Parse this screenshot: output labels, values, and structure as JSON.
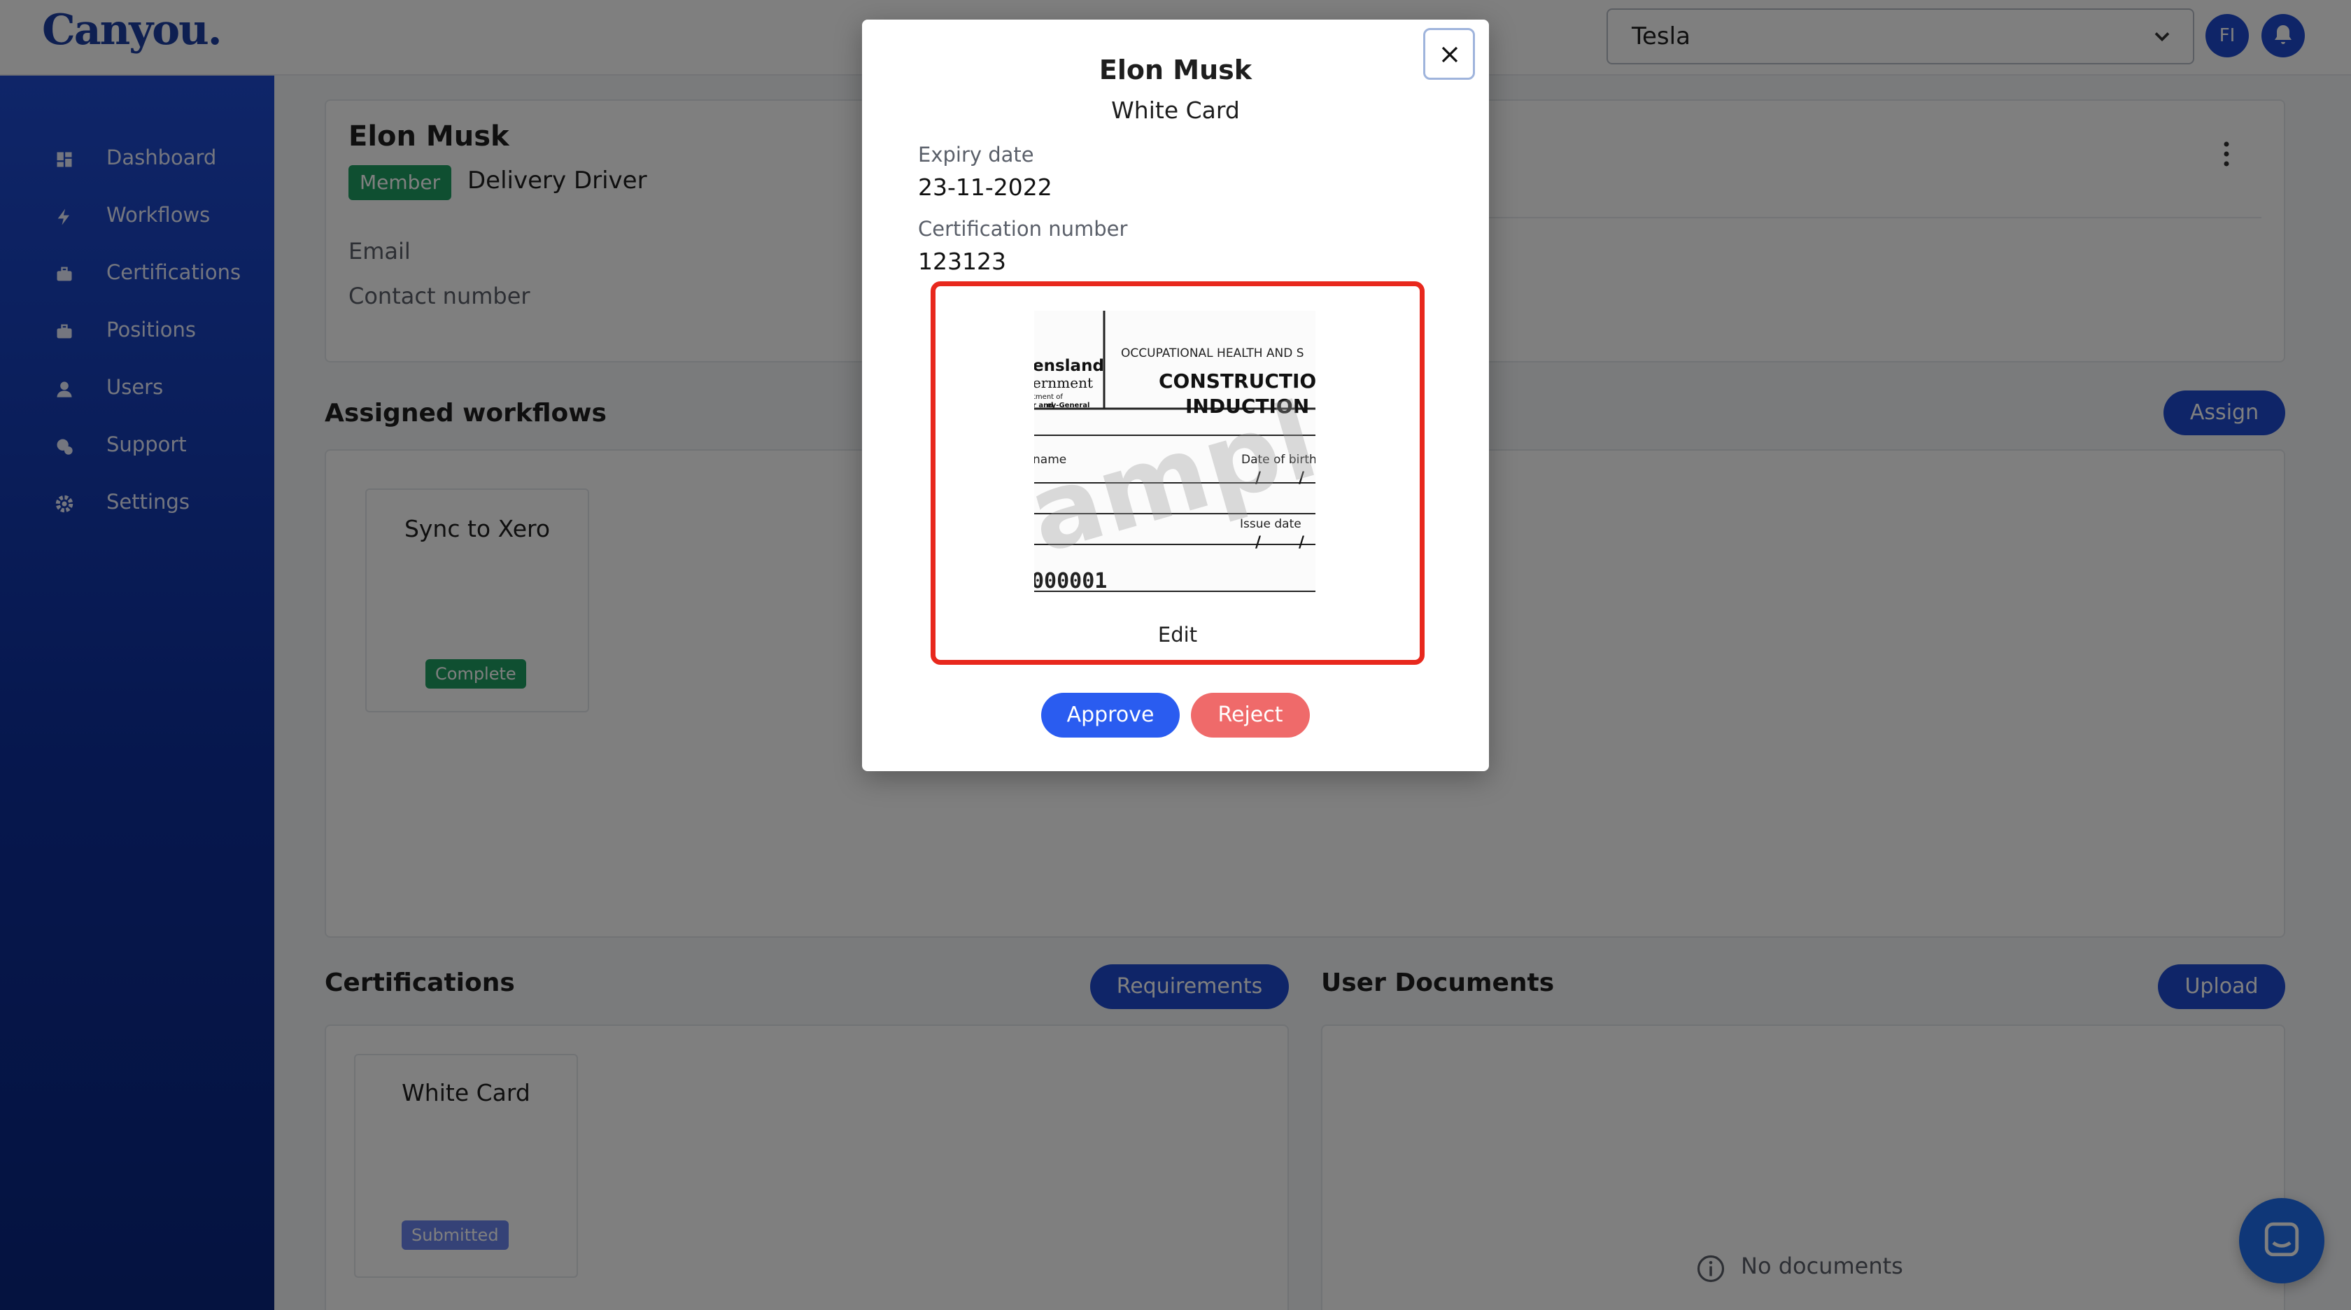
{
  "app": {
    "logo": "Canyou.",
    "company_select": "Tesla",
    "user_initials": "FI"
  },
  "sidebar": {
    "items": [
      {
        "label": "Dashboard",
        "icon": "dashboard-icon"
      },
      {
        "label": "Workflows",
        "icon": "bolt-icon"
      },
      {
        "label": "Certifications",
        "icon": "briefcase-icon"
      },
      {
        "label": "Positions",
        "icon": "briefcase-icon"
      },
      {
        "label": "Users",
        "icon": "user-icon"
      },
      {
        "label": "Support",
        "icon": "support-icon"
      },
      {
        "label": "Settings",
        "icon": "gear-icon"
      }
    ]
  },
  "profile": {
    "name": "Elon Musk",
    "role_badge": "Member",
    "position": "Delivery Driver",
    "email_label": "Email",
    "contact_label": "Contact number"
  },
  "workflows": {
    "title": "Assigned workflows",
    "assign_label": "Assign",
    "items": [
      {
        "title": "Sync to Xero",
        "status": "Complete"
      }
    ]
  },
  "certifications": {
    "title": "Certifications",
    "requirements_label": "Requirements",
    "items": [
      {
        "title": "White Card",
        "status": "Submitted"
      }
    ]
  },
  "documents": {
    "title": "User Documents",
    "upload_label": "Upload",
    "empty_text": "No documents"
  },
  "modal": {
    "title": "Elon Musk",
    "subtitle": "White Card",
    "expiry_label": "Expiry date",
    "expiry_value": "23-11-2022",
    "cert_number_label": "Certification number",
    "cert_number_value": "123123",
    "edit_label": "Edit",
    "approve_label": "Approve",
    "reject_label": "Reject",
    "card_image": {
      "org_line1": "ensland",
      "org_line2": "ernment",
      "org_line3": "tment of",
      "org_line4": "r and",
      "org_line5": "ey-General",
      "heading_small": "OCCUPATIONAL HEALTH AND S",
      "heading_line1": "CONSTRUCTION",
      "heading_line2": "INDUCTION",
      "name_label": "name",
      "dob_label": "Date of birth",
      "issue_label": "Issue date",
      "number": "000001",
      "watermark": "ample"
    }
  },
  "colors": {
    "brand": "#1e4bd1",
    "success": "#1e9e62",
    "danger": "#ef6a6a",
    "highlight": "#e8281d"
  }
}
